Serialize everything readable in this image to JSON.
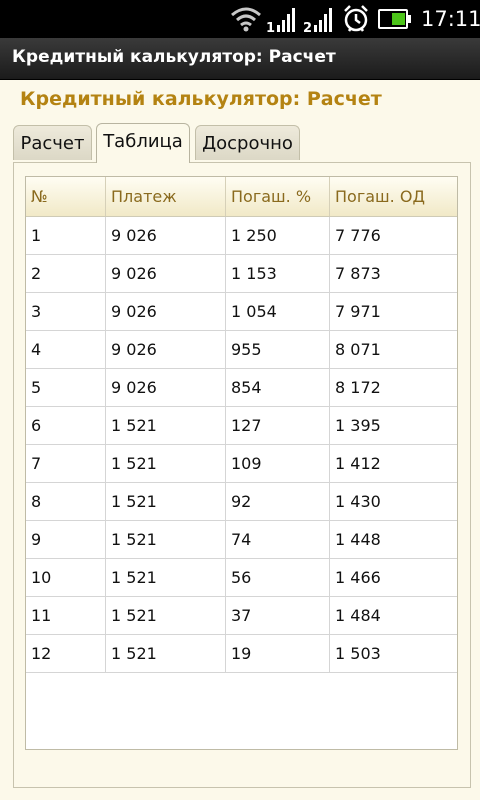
{
  "status_bar": {
    "time": "17:11",
    "icons": [
      "wifi-icon",
      "signal-icon",
      "signal-icon",
      "alarm-icon",
      "battery-icon"
    ]
  },
  "title_bar": {
    "title": "Кредитный калькулятор: Расчет"
  },
  "heading": "Кредитный калькулятор: Расчет",
  "tabs": [
    {
      "label": "Расчет",
      "active": false
    },
    {
      "label": "Таблица",
      "active": true
    },
    {
      "label": "Досрочно",
      "active": false
    }
  ],
  "table": {
    "columns": [
      "№",
      "Платеж",
      "Погаш. %",
      "Погаш. ОД"
    ],
    "rows": [
      [
        "1",
        "9 026",
        "1 250",
        "7 776"
      ],
      [
        "2",
        "9 026",
        "1 153",
        "7 873"
      ],
      [
        "3",
        "9 026",
        "1 054",
        "7 971"
      ],
      [
        "4",
        "9 026",
        "955",
        "8 071"
      ],
      [
        "5",
        "9 026",
        "854",
        "8 172"
      ],
      [
        "6",
        "1 521",
        "127",
        "1 395"
      ],
      [
        "7",
        "1 521",
        "109",
        "1 412"
      ],
      [
        "8",
        "1 521",
        "92",
        "1 430"
      ],
      [
        "9",
        "1 521",
        "74",
        "1 448"
      ],
      [
        "10",
        "1 521",
        "56",
        "1 466"
      ],
      [
        "11",
        "1 521",
        "37",
        "1 484"
      ],
      [
        "12",
        "1 521",
        "19",
        "1 503"
      ]
    ]
  },
  "colors": {
    "heading": "#b48312",
    "header_text": "#8a6a1e",
    "background": "#fcf9ea",
    "battery": "#4cc419"
  }
}
